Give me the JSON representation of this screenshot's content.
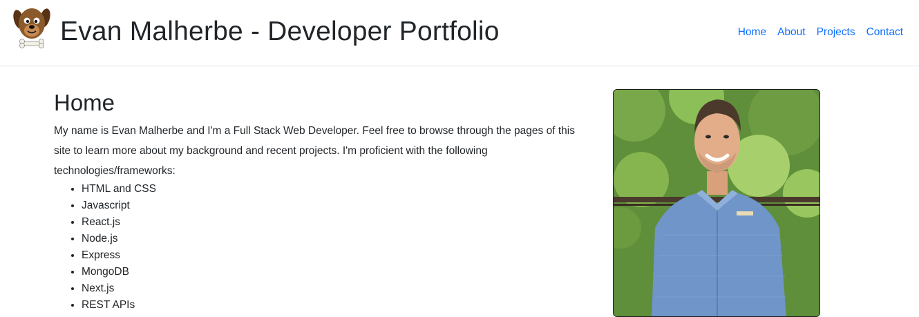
{
  "header": {
    "logo_icon": "cartoon-dog-logo-icon",
    "title": "Evan Malherbe - Developer Portfolio",
    "nav": [
      {
        "label": "Home"
      },
      {
        "label": "About"
      },
      {
        "label": "Projects"
      },
      {
        "label": "Contact"
      }
    ],
    "link_color": "#0d6efd"
  },
  "main": {
    "heading": "Home",
    "intro": "My name is Evan Malherbe and I'm a Full Stack Web Developer. Feel free to browse through the pages of this site to learn more about my background and recent projects. I'm proficient with the following technologies/frameworks:",
    "technologies": [
      "HTML and CSS",
      "Javascript",
      "React.js",
      "Node.js",
      "Express",
      "MongoDB",
      "Next.js",
      "REST APIs"
    ]
  },
  "photo": {
    "subject": "portrait-photo"
  }
}
